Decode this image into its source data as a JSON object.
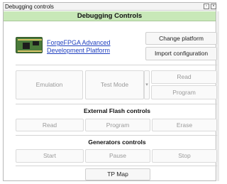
{
  "window": {
    "title": "Debugging controls"
  },
  "header": {
    "title": "Debugging Controls"
  },
  "device": {
    "link_line1": "ForgeFPGA Advanced",
    "link_line2": "Development Platform"
  },
  "actions": {
    "change_platform": "Change platform",
    "import_configuration": "Import configuration"
  },
  "mode": {
    "emulation": "Emulation",
    "test_mode": "Test Mode",
    "dropdown_glyph": "▾",
    "read": "Read",
    "program": "Program"
  },
  "external_flash": {
    "title": "External Flash controls",
    "read": "Read",
    "program": "Program",
    "erase": "Erase"
  },
  "generators": {
    "title": "Generators controls",
    "start": "Start",
    "pause": "Pause",
    "stop": "Stop"
  },
  "tp_map": {
    "label": "TP Map"
  },
  "colors": {
    "header_bg": "#c8e8b8",
    "link": "#1f3fbf",
    "disabled_text": "#9a9a9a"
  }
}
